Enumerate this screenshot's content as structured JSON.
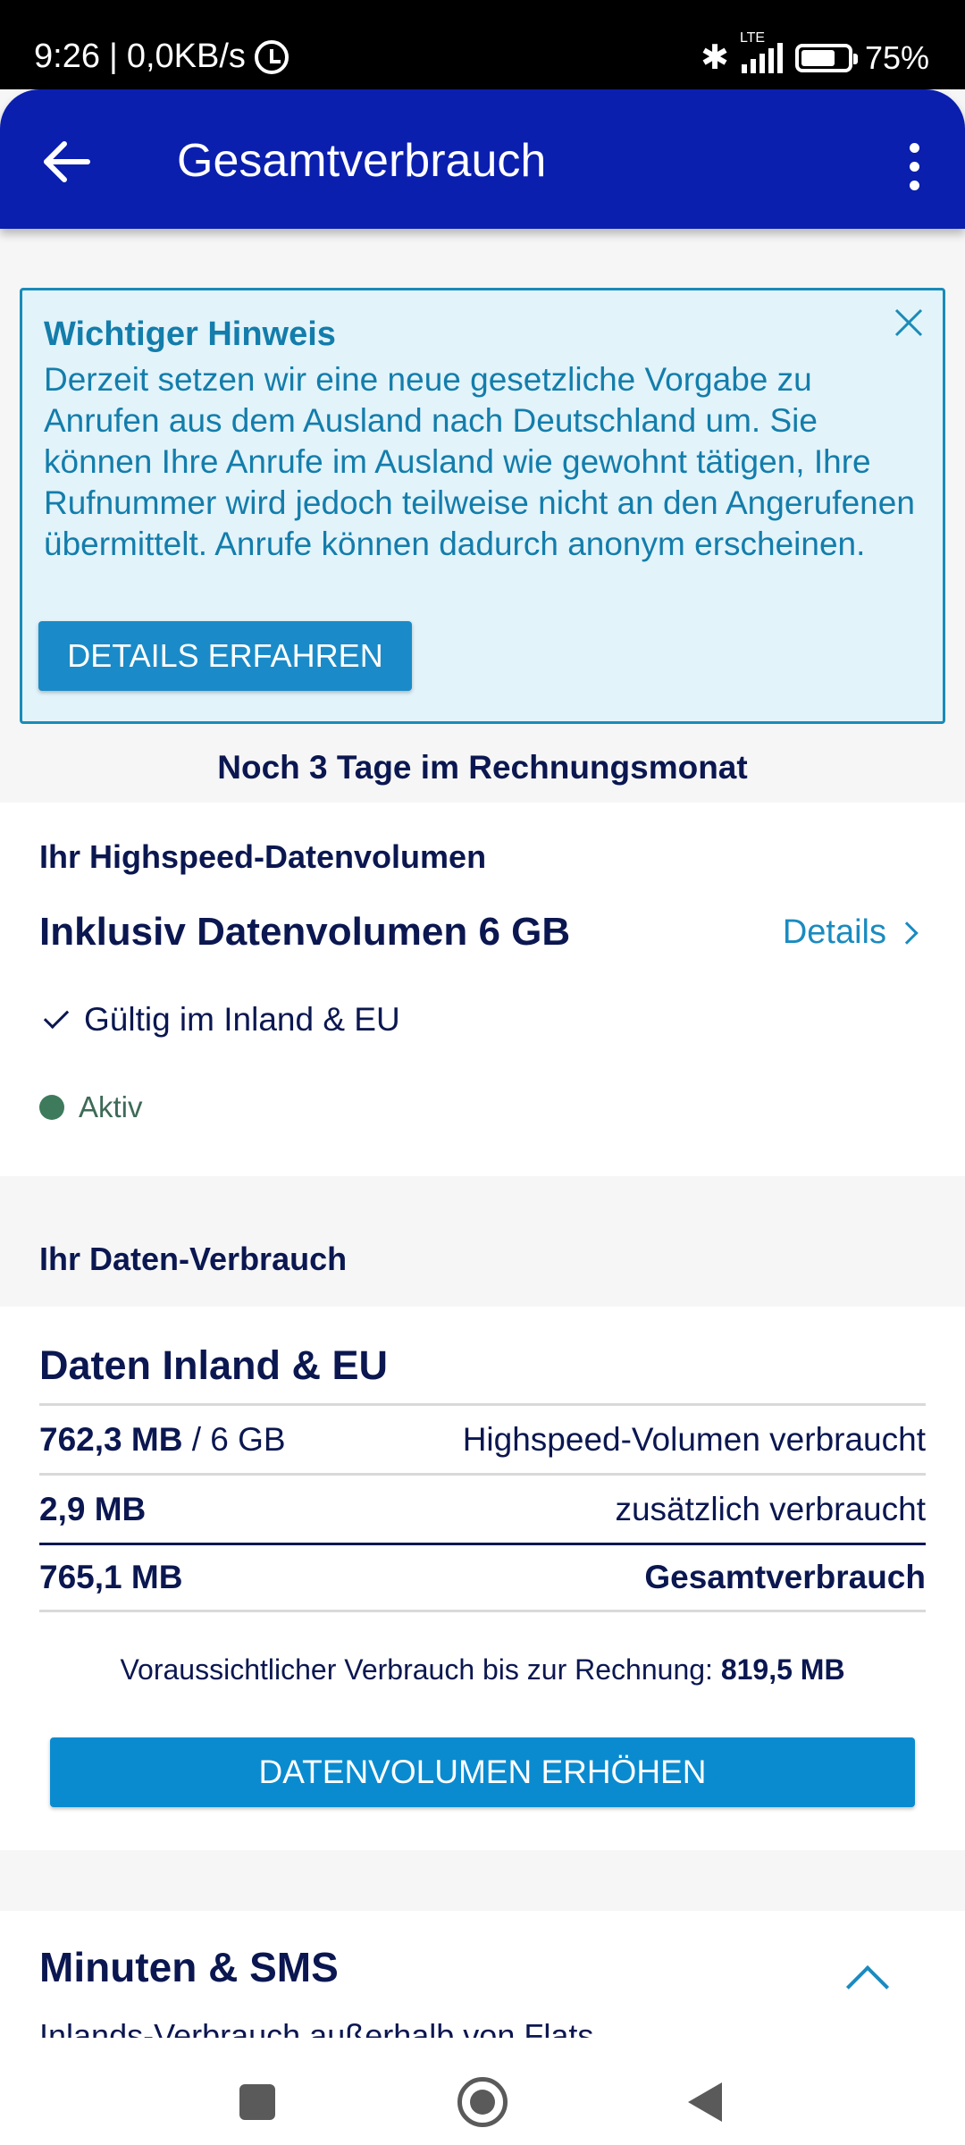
{
  "status_bar": {
    "time": "9:26",
    "network_speed": "0,0KB/s",
    "signal_label": "LTE",
    "battery": "75%"
  },
  "app_bar": {
    "title": "Gesamtverbrauch",
    "back_icon": "arrow-left-icon",
    "more_icon": "more-vertical-icon"
  },
  "notice": {
    "title": "Wichtiger Hinweis",
    "text": "Derzeit setzen wir eine neue gesetzliche Vorgabe zu Anrufen aus dem Ausland nach Deutschland um. Sie können Ihre Anrufe im Ausland wie gewohnt tätigen, Ihre Rufnummer wird jedoch teilweise nicht an den Angerufenen übermittelt. Anrufe können dadurch anonym erscheinen.",
    "button": "DETAILS ERFAHREN",
    "bg_color": "#e2f3fa",
    "accent_color": "#137dab"
  },
  "billing": {
    "remaining": "Noch 3 Tage im Rechnungsmonat"
  },
  "highspeed": {
    "section_label": "Ihr Highspeed-Datenvolumen",
    "tariff": "Inklusiv Datenvolumen 6 GB",
    "details_link": "Details",
    "validity": "Gültig im Inland & EU",
    "status": "Aktiv",
    "status_color": "#3e7a5c"
  },
  "consumption": {
    "section_label": "Ihr Daten-Verbrauch",
    "title": "Daten Inland & EU",
    "rows": [
      {
        "value": "762,3 MB",
        "of": " / 6 GB",
        "label": "Highspeed-Volumen verbraucht"
      },
      {
        "value": "2,9 MB",
        "of": "",
        "label": "zusätzlich verbraucht"
      },
      {
        "value": "765,1 MB",
        "of": "",
        "label": "Gesamtverbrauch"
      }
    ],
    "forecast_label": "Voraussichtlicher Verbrauch bis zur Rechnung: ",
    "forecast_value": "819,5 MB",
    "button": "DATENVOLUMEN ERHÖHEN",
    "button_color": "#0a8bd0"
  },
  "minutes": {
    "title": "Minuten & SMS",
    "subtitle": "Inlands-Verbrauch außerhalb von Flats"
  },
  "colors": {
    "app_bar": "#0a1fae",
    "text_primary": "#0b1750",
    "link": "#1a8bc0"
  }
}
